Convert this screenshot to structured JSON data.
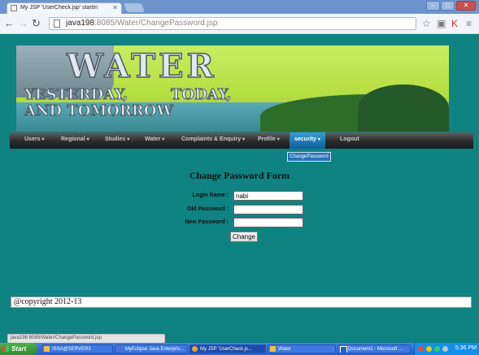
{
  "browser": {
    "tab_title": "My JSP 'UserCheck.jsp' startin",
    "url_host": "java198",
    "url_rest": ":8085/Water/ChangePassword.jsp",
    "status_url": "java198:8085/Water/ChangePassword.jsp"
  },
  "banner": {
    "title": "WATER",
    "tagline_1": "YESTERDAY,",
    "tagline_2": "TODAY,",
    "tagline_3": "AND TOMORROW"
  },
  "menu": {
    "items": [
      {
        "label": "Users"
      },
      {
        "label": "Regional"
      },
      {
        "label": "Studies"
      },
      {
        "label": "Water"
      },
      {
        "label": "Complaints & Enquiry"
      },
      {
        "label": "Profile"
      },
      {
        "label": "security"
      },
      {
        "label": "Logout"
      }
    ],
    "dropdown_item": "ChangePassword"
  },
  "form": {
    "title": "Change Password Form",
    "login_label": "Login Name :",
    "login_value": "nabi",
    "old_label": "Old Password :",
    "new_label": "New Password :",
    "button": "Change"
  },
  "footer": {
    "text": "@copyright 2012-13"
  },
  "taskbar": {
    "start": "Start",
    "items": [
      {
        "label": "ISSA@SERVER3"
      },
      {
        "label": "MyEclipse Java Enterpris..."
      },
      {
        "label": "My JSP 'UserCheck.js..."
      },
      {
        "label": "Water"
      },
      {
        "label": "Document1 - Microsoft ..."
      }
    ],
    "clock": "5:36 PM"
  }
}
